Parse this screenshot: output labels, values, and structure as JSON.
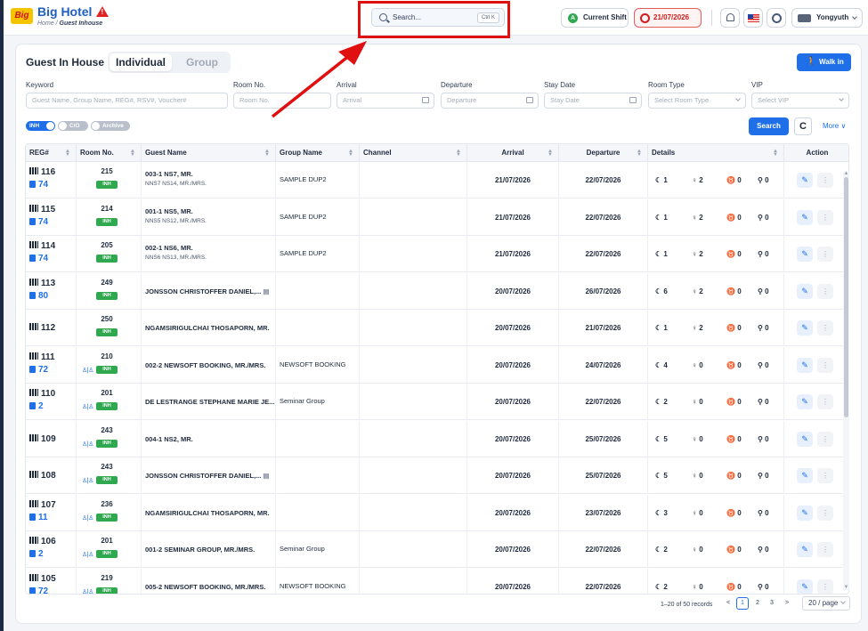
{
  "header": {
    "logo_text": "Big",
    "brand": "Big Hotel",
    "brand_warning": "!",
    "breadcrumb_home": "Home",
    "breadcrumb_sep": "/",
    "breadcrumb_current": "Guest Inhouse",
    "search_placeholder": "Search...",
    "search_shortcut": "Ctrl K",
    "shift_label": "Current Shift",
    "shift_badge": "A",
    "date_label": "21/07/2026",
    "user_name": "Yongyuth",
    "icons": [
      "bell-icon",
      "flag-icon",
      "theme-icon",
      "avatar-icon"
    ]
  },
  "page": {
    "title": "Guest In House",
    "tab_individual": "Individual",
    "tab_group": "Group",
    "walkin_label": "Walk in",
    "walkin_icon": "ꝏ"
  },
  "filters": {
    "keyword_label": "Keyword",
    "keyword_placeholder": "Guest Name, Group Name, REG#, RSV#, Voucher#",
    "room_label": "Room No.",
    "room_placeholder": "Room No.",
    "arrival_label": "Arrival",
    "arrival_placeholder": "Arrival",
    "departure_label": "Departure",
    "departure_placeholder": "Departure",
    "staydate_label": "Stay Date",
    "staydate_placeholder": "Stay Date",
    "roomtype_label": "Room Type",
    "roomtype_placeholder": "Select Room Type",
    "vip_label": "VIP",
    "vip_placeholder": "Select VIP",
    "toggle_inh": "INH",
    "toggle_co": "C/O",
    "toggle_archive": "Archive",
    "search_button": "Search",
    "refresh_icon": "C",
    "more_label": "More ∨"
  },
  "table": {
    "columns": [
      "REG#",
      "Room No.",
      "Guest Name",
      "Group Name",
      "Channel",
      "Arrival",
      "Departure",
      "Details",
      "Action"
    ],
    "status_badge": "INH",
    "rows": [
      {
        "reg": "116",
        "sub": "74",
        "room": "215",
        "pax_icon": false,
        "name": "003-1 NS7, MR.",
        "name2": "NNS7 NS14, MR./MRS.",
        "group": "SAMPLE DUP2",
        "arrival": "21/07/2026",
        "departure": "22/07/2026",
        "nights": "1",
        "adults": "2",
        "children": "0",
        "infants": "0",
        "lock": false
      },
      {
        "reg": "115",
        "sub": "74",
        "room": "214",
        "pax_icon": false,
        "name": "001-1 NS5, MR.",
        "name2": "NNS5 NS12, MR./MRS.",
        "group": "SAMPLE DUP2",
        "arrival": "21/07/2026",
        "departure": "22/07/2026",
        "nights": "1",
        "adults": "2",
        "children": "0",
        "infants": "0",
        "lock": false
      },
      {
        "reg": "114",
        "sub": "74",
        "room": "205",
        "pax_icon": false,
        "name": "002-1 NS6, MR.",
        "name2": "NNS6 NS13, MR./MRS.",
        "group": "SAMPLE DUP2",
        "arrival": "21/07/2026",
        "departure": "22/07/2026",
        "nights": "1",
        "adults": "2",
        "children": "0",
        "infants": "0",
        "lock": false
      },
      {
        "reg": "113",
        "sub": "80",
        "room": "249",
        "pax_icon": false,
        "name": "JONSSON CHRISTOFFER DANIEL,...",
        "name2": "",
        "group": "",
        "arrival": "20/07/2026",
        "departure": "26/07/2026",
        "nights": "6",
        "adults": "2",
        "children": "0",
        "infants": "0",
        "lock": true
      },
      {
        "reg": "112",
        "sub": "",
        "room": "250",
        "pax_icon": false,
        "name": "NGAMSIRIGULCHAI THOSAPORN, MR.",
        "name2": "",
        "group": "",
        "arrival": "20/07/2026",
        "departure": "21/07/2026",
        "nights": "1",
        "adults": "2",
        "children": "0",
        "infants": "0",
        "lock": false
      },
      {
        "reg": "111",
        "sub": "72",
        "room": "210",
        "pax_icon": true,
        "name": "002-2 NEWSOFT BOOKING, MR./MRS.",
        "name2": "",
        "group": "NEWSOFT BOOKING",
        "arrival": "20/07/2026",
        "departure": "24/07/2026",
        "nights": "4",
        "adults": "0",
        "children": "0",
        "infants": "0",
        "lock": false
      },
      {
        "reg": "110",
        "sub": "2",
        "room": "201",
        "pax_icon": true,
        "name": "DE LESTRANGE STEPHANE MARIE JE...",
        "name2": "",
        "group": "Seminar Group",
        "arrival": "20/07/2026",
        "departure": "22/07/2026",
        "nights": "2",
        "adults": "0",
        "children": "0",
        "infants": "0",
        "lock": false
      },
      {
        "reg": "109",
        "sub": "",
        "room": "243",
        "pax_icon": true,
        "name": "004-1 NS2, MR.",
        "name2": "",
        "group": "",
        "arrival": "20/07/2026",
        "departure": "25/07/2026",
        "nights": "5",
        "adults": "0",
        "children": "0",
        "infants": "0",
        "lock": false
      },
      {
        "reg": "108",
        "sub": "",
        "room": "243",
        "pax_icon": true,
        "name": "JONSSON CHRISTOFFER DANIEL,...",
        "name2": "",
        "group": "",
        "arrival": "20/07/2026",
        "departure": "25/07/2026",
        "nights": "5",
        "adults": "0",
        "children": "0",
        "infants": "0",
        "lock": true
      },
      {
        "reg": "107",
        "sub": "11",
        "room": "236",
        "pax_icon": true,
        "name": "NGAMSIRIGULCHAI THOSAPORN, MR.",
        "name2": "",
        "group": "",
        "arrival": "20/07/2026",
        "departure": "23/07/2026",
        "nights": "3",
        "adults": "0",
        "children": "0",
        "infants": "0",
        "lock": false
      },
      {
        "reg": "106",
        "sub": "2",
        "room": "201",
        "pax_icon": true,
        "name": "001-2 SEMINAR GROUP, MR./MRS.",
        "name2": "",
        "group": "Seminar Group",
        "arrival": "20/07/2026",
        "departure": "22/07/2026",
        "nights": "2",
        "adults": "0",
        "children": "0",
        "infants": "0",
        "lock": false
      },
      {
        "reg": "105",
        "sub": "72",
        "room": "219",
        "pax_icon": true,
        "name": "005-2 NEWSOFT BOOKING, MR./MRS.",
        "name2": "",
        "group": "NEWSOFT BOOKING",
        "arrival": "20/07/2026",
        "departure": "22/07/2026",
        "nights": "2",
        "adults": "0",
        "children": "0",
        "infants": "0",
        "lock": false
      }
    ]
  },
  "pagination": {
    "info": "1–20 of 50 records",
    "prev": "<",
    "pages": [
      "1",
      "2",
      "3"
    ],
    "next": ">",
    "page_size": "20 / page"
  },
  "colors": {
    "primary": "#1e6fe8",
    "inh_green": "#2fa84f",
    "alert_red": "#e01010"
  }
}
